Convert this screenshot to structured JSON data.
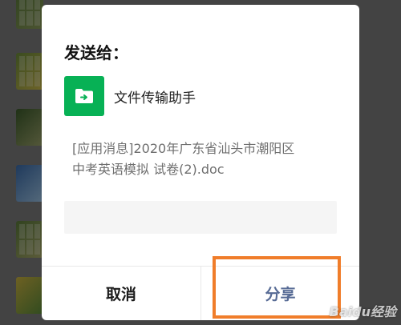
{
  "dialog": {
    "title": "发送给：",
    "recipient": {
      "name": "文件传输助手",
      "icon": "file-transfer-folder-icon",
      "icon_color": "#07b155"
    },
    "message": "[应用消息]2020年广东省汕头市潮阳区中考英语模拟 试卷(2).doc",
    "input": {
      "value": "",
      "placeholder": ""
    },
    "buttons": {
      "cancel_label": "取消",
      "share_label": "分享"
    },
    "colors": {
      "share_text": "#576b95",
      "cancel_text": "#1a1a1a",
      "highlight": "#f07d2a"
    }
  },
  "watermark": "Baidu经验"
}
